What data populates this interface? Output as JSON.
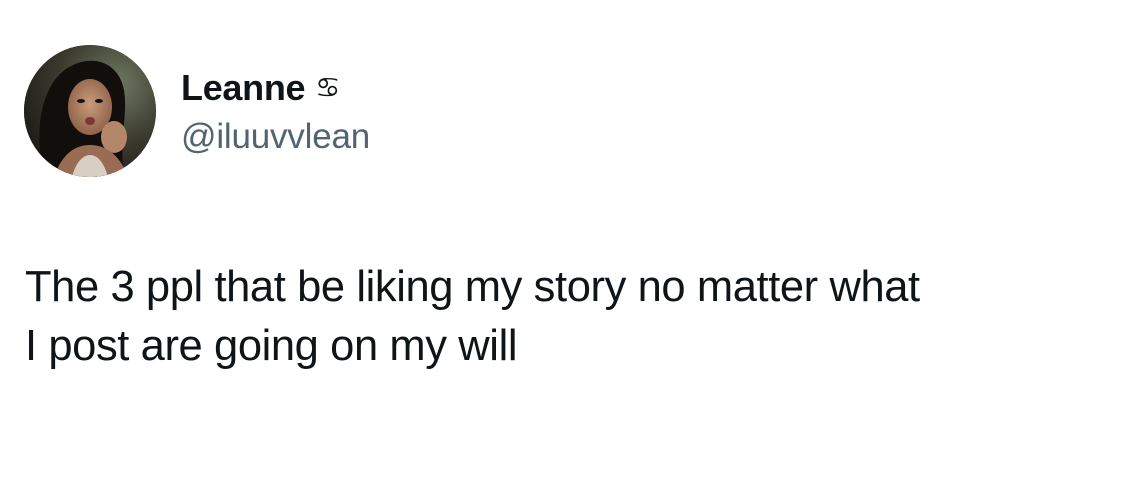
{
  "author": {
    "display_name": "Leanne",
    "zodiac_badge": "♋",
    "handle": "@iluuvvlean",
    "avatar_icon": "profile-photo"
  },
  "tweet": {
    "lines": [
      "The 3 ppl that be liking my story no matter what",
      "I post are going on my will"
    ]
  }
}
